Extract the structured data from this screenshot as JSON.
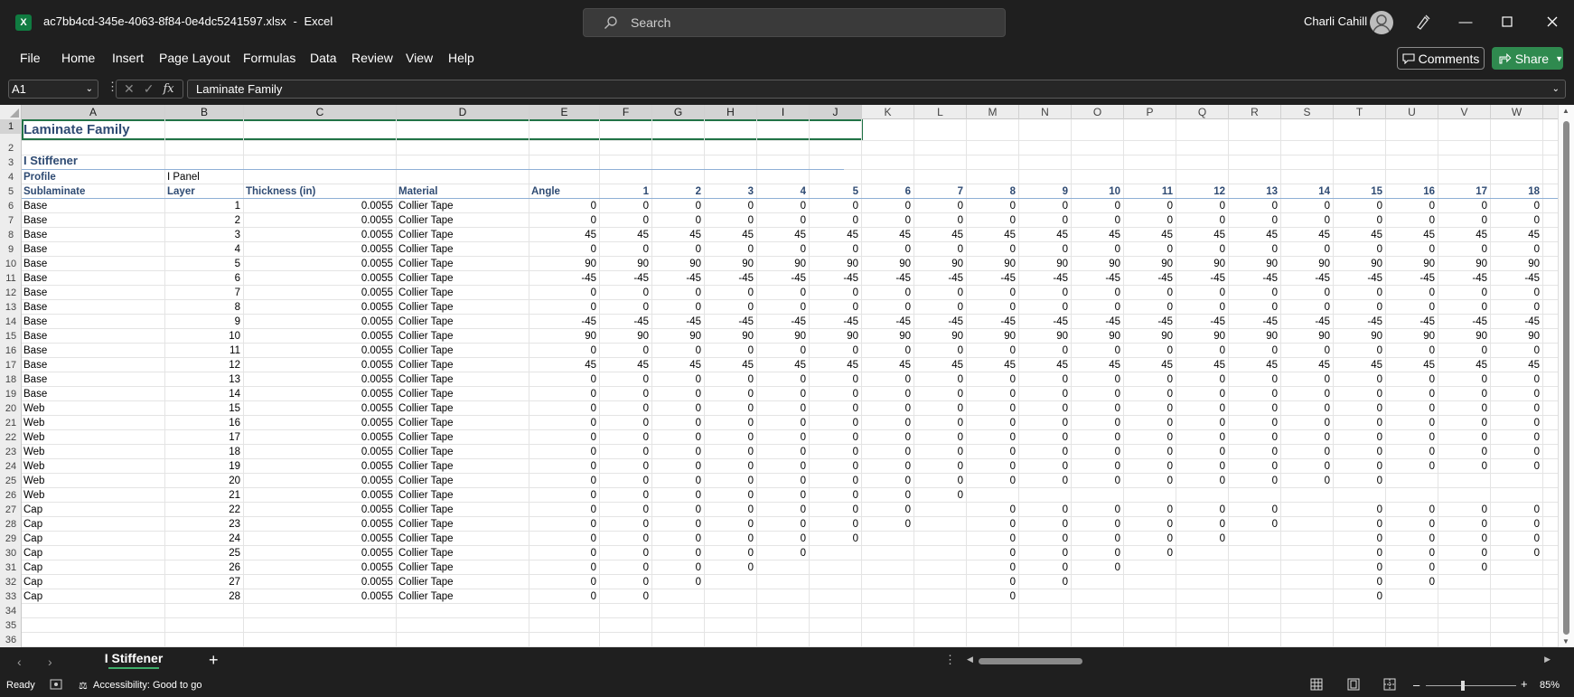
{
  "app": {
    "filename": "ac7bb4cd-345e-4063-8f84-0e4dc5241597.xlsx",
    "separator": "-",
    "appname": "Excel",
    "logo_letter": "X",
    "search_placeholder": "Search",
    "user": "Charli Cahill"
  },
  "menu": [
    "File",
    "Home",
    "Insert",
    "Page Layout",
    "Formulas",
    "Data",
    "Review",
    "View",
    "Help"
  ],
  "buttons": {
    "comments": "Comments",
    "share": "Share"
  },
  "formula_bar": {
    "name_box": "A1",
    "fx": "fx",
    "content": "Laminate Family"
  },
  "columns": [
    "A",
    "B",
    "C",
    "D",
    "E",
    "F",
    "G",
    "H",
    "I",
    "J",
    "K",
    "L",
    "M",
    "N",
    "O",
    "P",
    "Q",
    "R",
    "S",
    "T",
    "U",
    "V",
    "W"
  ],
  "rows": [
    "1",
    "2",
    "3",
    "4",
    "5",
    "6",
    "7",
    "8",
    "9",
    "10",
    "11",
    "12",
    "13",
    "14",
    "15",
    "16",
    "17",
    "18",
    "19",
    "20",
    "21",
    "22",
    "23",
    "24",
    "25",
    "26",
    "27",
    "28",
    "29",
    "30",
    "31",
    "32",
    "33",
    "34",
    "35",
    "36"
  ],
  "sheet": {
    "title": "Laminate Family",
    "subtitle": "I Stiffener",
    "profile_label": "Profile",
    "profile_value": "I Panel",
    "headers": [
      "Sublaminate",
      "Layer",
      "Thickness (in)",
      "Material",
      "Angle"
    ],
    "ply_numbers": [
      "1",
      "2",
      "3",
      "4",
      "5",
      "6",
      "7",
      "8",
      "9",
      "10",
      "11",
      "12",
      "13",
      "14",
      "15",
      "16",
      "17",
      "18"
    ],
    "data": [
      {
        "sub": "Base",
        "layer": "1",
        "thk": "0.0055",
        "mat": "Collier Tape",
        "vals": [
          "0",
          "0",
          "0",
          "0",
          "0",
          "0",
          "0",
          "0",
          "0",
          "0",
          "0",
          "0",
          "0",
          "0",
          "0",
          "0",
          "0",
          "0",
          "0"
        ]
      },
      {
        "sub": "Base",
        "layer": "2",
        "thk": "0.0055",
        "mat": "Collier Tape",
        "vals": [
          "0",
          "0",
          "0",
          "0",
          "0",
          "0",
          "0",
          "0",
          "0",
          "0",
          "0",
          "0",
          "0",
          "0",
          "0",
          "0",
          "0",
          "0",
          "0"
        ]
      },
      {
        "sub": "Base",
        "layer": "3",
        "thk": "0.0055",
        "mat": "Collier Tape",
        "vals": [
          "45",
          "45",
          "45",
          "45",
          "45",
          "45",
          "45",
          "45",
          "45",
          "45",
          "45",
          "45",
          "45",
          "45",
          "45",
          "45",
          "45",
          "45",
          "45"
        ]
      },
      {
        "sub": "Base",
        "layer": "4",
        "thk": "0.0055",
        "mat": "Collier Tape",
        "vals": [
          "0",
          "0",
          "0",
          "0",
          "0",
          "0",
          "0",
          "0",
          "0",
          "0",
          "0",
          "0",
          "0",
          "0",
          "0",
          "0",
          "0",
          "0",
          "0"
        ]
      },
      {
        "sub": "Base",
        "layer": "5",
        "thk": "0.0055",
        "mat": "Collier Tape",
        "vals": [
          "90",
          "90",
          "90",
          "90",
          "90",
          "90",
          "90",
          "90",
          "90",
          "90",
          "90",
          "90",
          "90",
          "90",
          "90",
          "90",
          "90",
          "90",
          "90"
        ]
      },
      {
        "sub": "Base",
        "layer": "6",
        "thk": "0.0055",
        "mat": "Collier Tape",
        "vals": [
          "-45",
          "-45",
          "-45",
          "-45",
          "-45",
          "-45",
          "-45",
          "-45",
          "-45",
          "-45",
          "-45",
          "-45",
          "-45",
          "-45",
          "-45",
          "-45",
          "-45",
          "-45",
          "-45"
        ]
      },
      {
        "sub": "Base",
        "layer": "7",
        "thk": "0.0055",
        "mat": "Collier Tape",
        "vals": [
          "0",
          "0",
          "0",
          "0",
          "0",
          "0",
          "0",
          "0",
          "0",
          "0",
          "0",
          "0",
          "0",
          "0",
          "0",
          "0",
          "0",
          "0",
          "0"
        ]
      },
      {
        "sub": "Base",
        "layer": "8",
        "thk": "0.0055",
        "mat": "Collier Tape",
        "vals": [
          "0",
          "0",
          "0",
          "0",
          "0",
          "0",
          "0",
          "0",
          "0",
          "0",
          "0",
          "0",
          "0",
          "0",
          "0",
          "0",
          "0",
          "0",
          "0"
        ]
      },
      {
        "sub": "Base",
        "layer": "9",
        "thk": "0.0055",
        "mat": "Collier Tape",
        "vals": [
          "-45",
          "-45",
          "-45",
          "-45",
          "-45",
          "-45",
          "-45",
          "-45",
          "-45",
          "-45",
          "-45",
          "-45",
          "-45",
          "-45",
          "-45",
          "-45",
          "-45",
          "-45",
          "-45"
        ]
      },
      {
        "sub": "Base",
        "layer": "10",
        "thk": "0.0055",
        "mat": "Collier Tape",
        "vals": [
          "90",
          "90",
          "90",
          "90",
          "90",
          "90",
          "90",
          "90",
          "90",
          "90",
          "90",
          "90",
          "90",
          "90",
          "90",
          "90",
          "90",
          "90",
          "90"
        ]
      },
      {
        "sub": "Base",
        "layer": "11",
        "thk": "0.0055",
        "mat": "Collier Tape",
        "vals": [
          "0",
          "0",
          "0",
          "0",
          "0",
          "0",
          "0",
          "0",
          "0",
          "0",
          "0",
          "0",
          "0",
          "0",
          "0",
          "0",
          "0",
          "0",
          "0"
        ]
      },
      {
        "sub": "Base",
        "layer": "12",
        "thk": "0.0055",
        "mat": "Collier Tape",
        "vals": [
          "45",
          "45",
          "45",
          "45",
          "45",
          "45",
          "45",
          "45",
          "45",
          "45",
          "45",
          "45",
          "45",
          "45",
          "45",
          "45",
          "45",
          "45",
          "45"
        ]
      },
      {
        "sub": "Base",
        "layer": "13",
        "thk": "0.0055",
        "mat": "Collier Tape",
        "vals": [
          "0",
          "0",
          "0",
          "0",
          "0",
          "0",
          "0",
          "0",
          "0",
          "0",
          "0",
          "0",
          "0",
          "0",
          "0",
          "0",
          "0",
          "0",
          "0"
        ]
      },
      {
        "sub": "Base",
        "layer": "14",
        "thk": "0.0055",
        "mat": "Collier Tape",
        "vals": [
          "0",
          "0",
          "0",
          "0",
          "0",
          "0",
          "0",
          "0",
          "0",
          "0",
          "0",
          "0",
          "0",
          "0",
          "0",
          "0",
          "0",
          "0",
          "0"
        ]
      },
      {
        "sub": "Web",
        "layer": "15",
        "thk": "0.0055",
        "mat": "Collier Tape",
        "vals": [
          "0",
          "0",
          "0",
          "0",
          "0",
          "0",
          "0",
          "0",
          "0",
          "0",
          "0",
          "0",
          "0",
          "0",
          "0",
          "0",
          "0",
          "0",
          "0"
        ]
      },
      {
        "sub": "Web",
        "layer": "16",
        "thk": "0.0055",
        "mat": "Collier Tape",
        "vals": [
          "0",
          "0",
          "0",
          "0",
          "0",
          "0",
          "0",
          "0",
          "0",
          "0",
          "0",
          "0",
          "0",
          "0",
          "0",
          "0",
          "0",
          "0",
          "0"
        ]
      },
      {
        "sub": "Web",
        "layer": "17",
        "thk": "0.0055",
        "mat": "Collier Tape",
        "vals": [
          "0",
          "0",
          "0",
          "0",
          "0",
          "0",
          "0",
          "0",
          "0",
          "0",
          "0",
          "0",
          "0",
          "0",
          "0",
          "0",
          "0",
          "0",
          "0"
        ]
      },
      {
        "sub": "Web",
        "layer": "18",
        "thk": "0.0055",
        "mat": "Collier Tape",
        "vals": [
          "0",
          "0",
          "0",
          "0",
          "0",
          "0",
          "0",
          "0",
          "0",
          "0",
          "0",
          "0",
          "0",
          "0",
          "0",
          "0",
          "0",
          "0",
          "0"
        ]
      },
      {
        "sub": "Web",
        "layer": "19",
        "thk": "0.0055",
        "mat": "Collier Tape",
        "vals": [
          "0",
          "0",
          "0",
          "0",
          "0",
          "0",
          "0",
          "0",
          "0",
          "0",
          "0",
          "0",
          "0",
          "0",
          "0",
          "0",
          "0",
          "0",
          "0"
        ]
      },
      {
        "sub": "Web",
        "layer": "20",
        "thk": "0.0055",
        "mat": "Collier Tape",
        "vals": [
          "0",
          "0",
          "0",
          "0",
          "0",
          "0",
          "0",
          "0",
          "0",
          "0",
          "0",
          "0",
          "0",
          "0",
          "0",
          "0",
          "",
          "",
          ""
        ]
      },
      {
        "sub": "Web",
        "layer": "21",
        "thk": "0.0055",
        "mat": "Collier Tape",
        "vals": [
          "0",
          "0",
          "0",
          "0",
          "0",
          "0",
          "0",
          "0",
          "",
          "",
          "",
          "",
          "",
          "",
          "",
          "",
          "",
          "",
          ""
        ]
      },
      {
        "sub": "Cap",
        "layer": "22",
        "thk": "0.0055",
        "mat": "Collier Tape",
        "vals": [
          "0",
          "0",
          "0",
          "0",
          "0",
          "0",
          "0",
          "",
          "0",
          "0",
          "0",
          "0",
          "0",
          "0",
          "",
          "0",
          "0",
          "0",
          "0"
        ]
      },
      {
        "sub": "Cap",
        "layer": "23",
        "thk": "0.0055",
        "mat": "Collier Tape",
        "vals": [
          "0",
          "0",
          "0",
          "0",
          "0",
          "0",
          "0",
          "",
          "0",
          "0",
          "0",
          "0",
          "0",
          "0",
          "",
          "0",
          "0",
          "0",
          "0"
        ]
      },
      {
        "sub": "Cap",
        "layer": "24",
        "thk": "0.0055",
        "mat": "Collier Tape",
        "vals": [
          "0",
          "0",
          "0",
          "0",
          "0",
          "0",
          "",
          "",
          "0",
          "0",
          "0",
          "0",
          "0",
          "",
          "",
          "0",
          "0",
          "0",
          "0"
        ]
      },
      {
        "sub": "Cap",
        "layer": "25",
        "thk": "0.0055",
        "mat": "Collier Tape",
        "vals": [
          "0",
          "0",
          "0",
          "0",
          "0",
          "",
          "",
          "",
          "0",
          "0",
          "0",
          "0",
          "",
          "",
          "",
          "0",
          "0",
          "0",
          "0"
        ]
      },
      {
        "sub": "Cap",
        "layer": "26",
        "thk": "0.0055",
        "mat": "Collier Tape",
        "vals": [
          "0",
          "0",
          "0",
          "0",
          "",
          "",
          "",
          "",
          "0",
          "0",
          "0",
          "",
          "",
          "",
          "",
          "0",
          "0",
          "0",
          ""
        ]
      },
      {
        "sub": "Cap",
        "layer": "27",
        "thk": "0.0055",
        "mat": "Collier Tape",
        "vals": [
          "0",
          "0",
          "0",
          "",
          "",
          "",
          "",
          "",
          "0",
          "0",
          "",
          "",
          "",
          "",
          "",
          "0",
          "0",
          "",
          ""
        ]
      },
      {
        "sub": "Cap",
        "layer": "28",
        "thk": "0.0055",
        "mat": "Collier Tape",
        "vals": [
          "0",
          "0",
          "",
          "",
          "",
          "",
          "",
          "",
          "0",
          "",
          "",
          "",
          "",
          "",
          "",
          "0",
          "",
          "",
          ""
        ]
      }
    ]
  },
  "sheet_tabs": [
    "I Stiffener"
  ],
  "status": {
    "ready": "Ready",
    "accessibility": "Accessibility: Good to go",
    "zoom": "85%"
  }
}
